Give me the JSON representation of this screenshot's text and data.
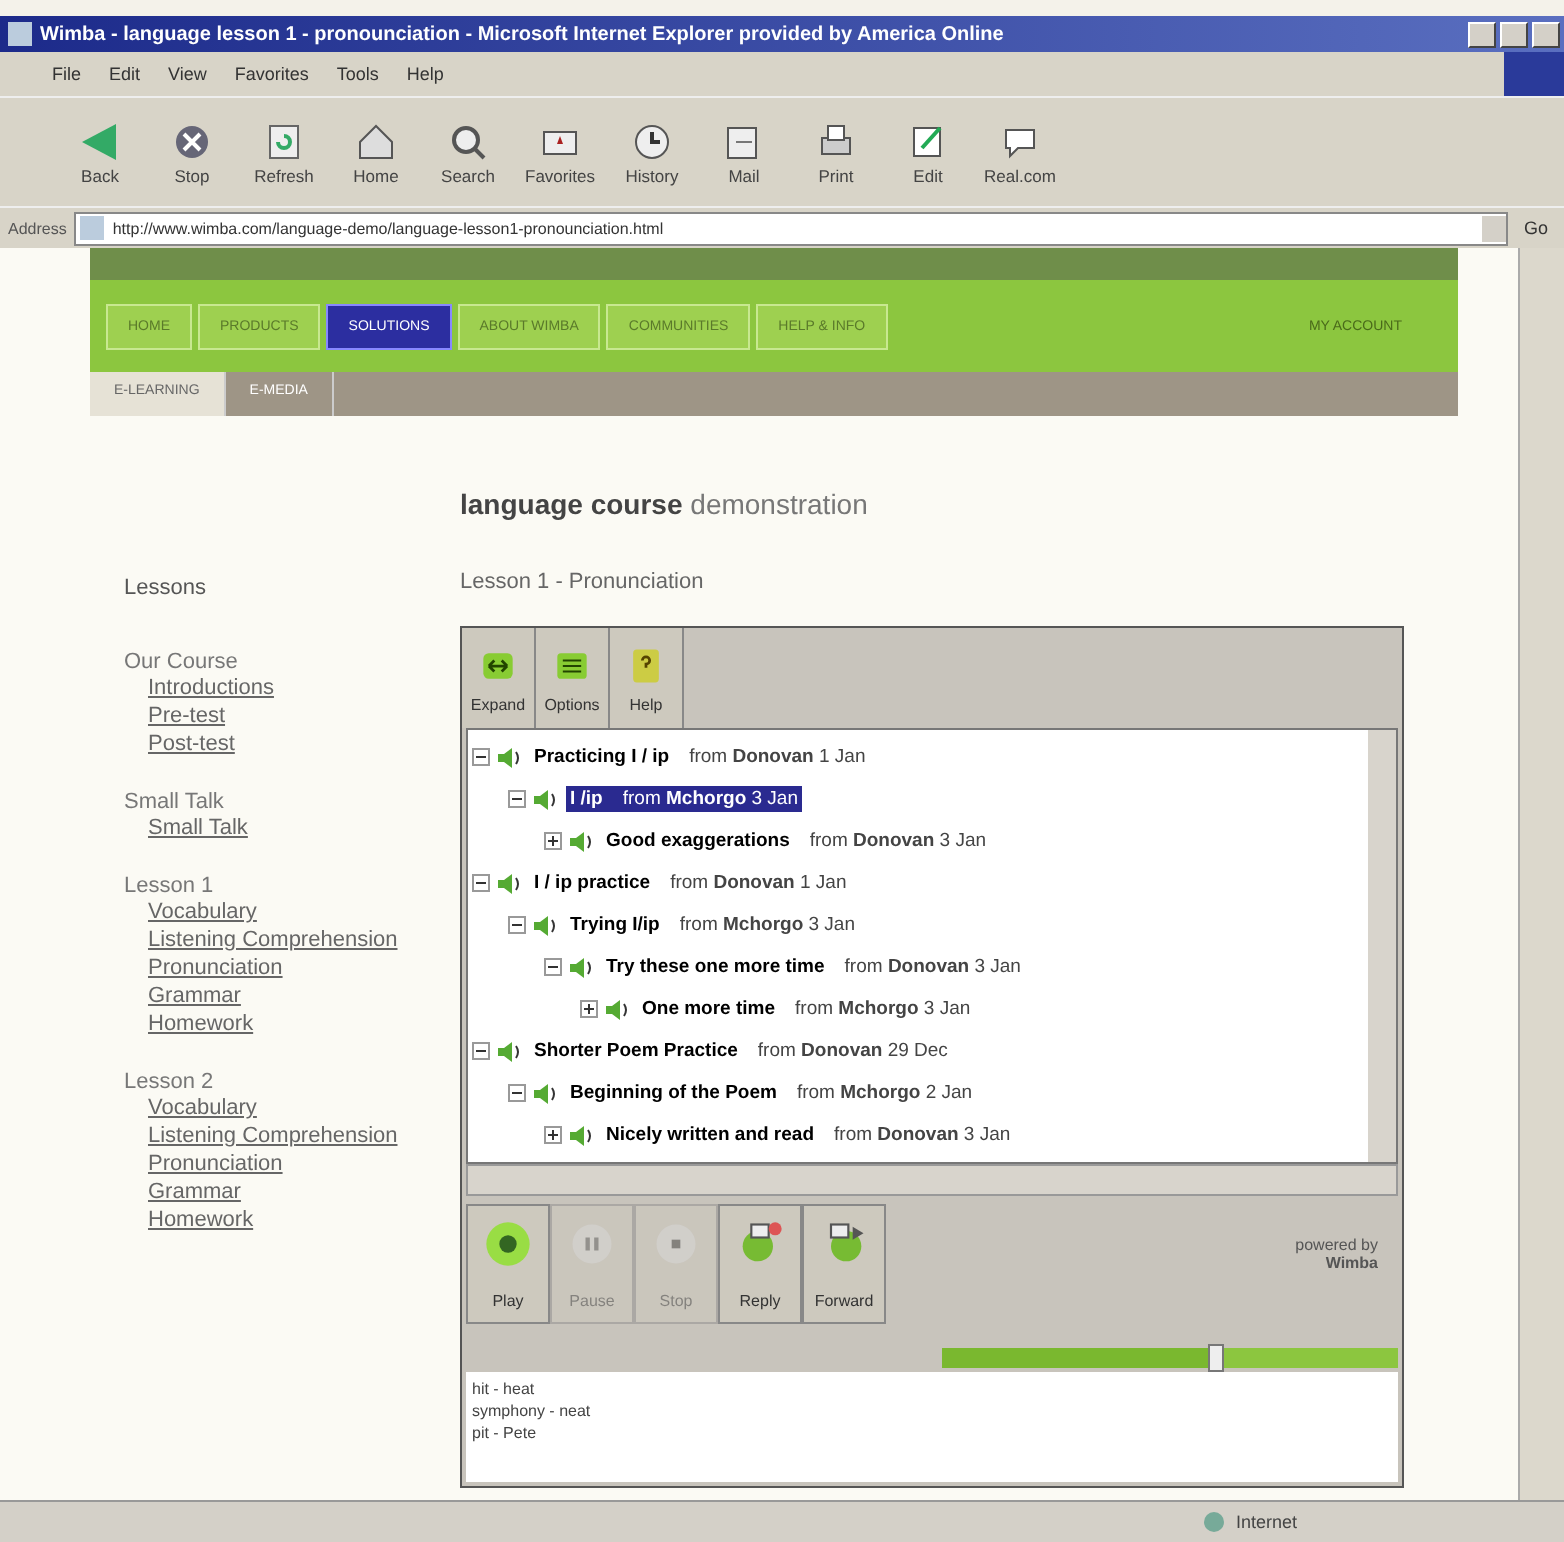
{
  "window": {
    "title": "Wimba - language lesson 1 - pronounciation - Microsoft Internet Explorer provided by America Online"
  },
  "menu": [
    "File",
    "Edit",
    "View",
    "Favorites",
    "Tools",
    "Help"
  ],
  "toolbar": [
    {
      "label": "Back",
      "kind": "back"
    },
    {
      "label": "Stop",
      "kind": "stop"
    },
    {
      "label": "Refresh",
      "kind": "refresh"
    },
    {
      "label": "Home",
      "kind": "home"
    },
    {
      "label": "Search",
      "kind": "search"
    },
    {
      "label": "Favorites",
      "kind": "favorites"
    },
    {
      "label": "History",
      "kind": "history"
    },
    {
      "label": "Mail",
      "kind": "mail"
    },
    {
      "label": "Print",
      "kind": "print"
    },
    {
      "label": "Edit",
      "kind": "edit"
    },
    {
      "label": "Real.com",
      "kind": "real"
    }
  ],
  "address": {
    "label": "Address",
    "value": "http://www.wimba.com/language-demo/language-lesson1-pronounciation.html",
    "go": "Go"
  },
  "nav": [
    {
      "label": "HOME",
      "selected": false
    },
    {
      "label": "PRODUCTS",
      "selected": false
    },
    {
      "label": "SOLUTIONS",
      "selected": true
    },
    {
      "label": "ABOUT WIMBA",
      "selected": false
    },
    {
      "label": "COMMUNITIES",
      "selected": false
    },
    {
      "label": "HELP & INFO",
      "selected": false
    }
  ],
  "account": "MY ACCOUNT",
  "subtabs": [
    {
      "label": "E-LEARNING",
      "selected": true
    },
    {
      "label": "E-MEDIA",
      "selected": false
    }
  ],
  "heading": "**language course** demonstration",
  "sidebar": {
    "title": "Lessons",
    "groups": [
      {
        "label": "Our Course",
        "links": [
          "Introductions",
          "Pre-test",
          "Post-test"
        ]
      },
      {
        "label": "Small Talk",
        "links": [
          "Small Talk"
        ]
      },
      {
        "label": "Lesson 1",
        "links": [
          "Vocabulary",
          "Listening Comprehension",
          "Pronunciation",
          "Grammar",
          "Homework"
        ]
      },
      {
        "label": "Lesson 2",
        "links": [
          "Vocabulary",
          "Listening Comprehension",
          "Pronunciation",
          "Grammar",
          "Homework"
        ]
      }
    ]
  },
  "lesson_title": "Lesson 1 - Pronunciation",
  "board": {
    "tools": [
      {
        "label": "Expand",
        "kind": "expand"
      },
      {
        "label": "Options",
        "kind": "options"
      },
      {
        "label": "Help",
        "kind": "help"
      }
    ],
    "messages": [
      {
        "title": "Practicing I / ip",
        "byline": "from **Donovan** 1 Jan",
        "expanded": true,
        "selected": false,
        "children": [
          {
            "title": "I /ip",
            "byline": "from **Mchorgo** 3 Jan",
            "expanded": true,
            "selected": true,
            "children": [
              {
                "title": "Good exaggerations",
                "byline": "from **Donovan** 3 Jan",
                "expanded": false,
                "selected": false
              }
            ]
          }
        ]
      },
      {
        "title": "I / ip practice",
        "byline": "from **Donovan** 1 Jan",
        "expanded": true,
        "selected": false,
        "children": [
          {
            "title": "Trying I/ip",
            "byline": "from **Mchorgo** 3 Jan",
            "expanded": true,
            "selected": false,
            "children": [
              {
                "title": "Try these one more time",
                "byline": "from **Donovan** 3 Jan",
                "expanded": true,
                "selected": false,
                "children": [
                  {
                    "title": "One more time",
                    "byline": "from **Mchorgo** 3 Jan",
                    "expanded": false,
                    "selected": false
                  }
                ]
              }
            ]
          }
        ]
      },
      {
        "title": "Shorter Poem Practice",
        "byline": "from **Donovan** 29 Dec",
        "expanded": true,
        "selected": false,
        "children": [
          {
            "title": "Beginning of the Poem",
            "byline": "from **Mchorgo** 2 Jan",
            "expanded": true,
            "selected": false,
            "children": [
              {
                "title": "Nicely written and read",
                "byline": "from **Donovan** 3 Jan",
                "expanded": false,
                "selected": false
              }
            ]
          }
        ]
      }
    ],
    "player": [
      {
        "label": "Play",
        "kind": "play",
        "disabled": false
      },
      {
        "label": "Pause",
        "kind": "pause",
        "disabled": true
      },
      {
        "label": "Stop",
        "kind": "stop",
        "disabled": true
      },
      {
        "label": "Reply",
        "kind": "reply",
        "disabled": false
      },
      {
        "label": "Forward",
        "kind": "forward",
        "disabled": false
      }
    ],
    "powered": "powered by **Wimba**",
    "progress": {
      "level": 0.6
    },
    "notes": [
      "hit - heat",
      "symphony - neat",
      "pit - Pete"
    ]
  },
  "status_bar": {
    "zone": "Internet"
  }
}
